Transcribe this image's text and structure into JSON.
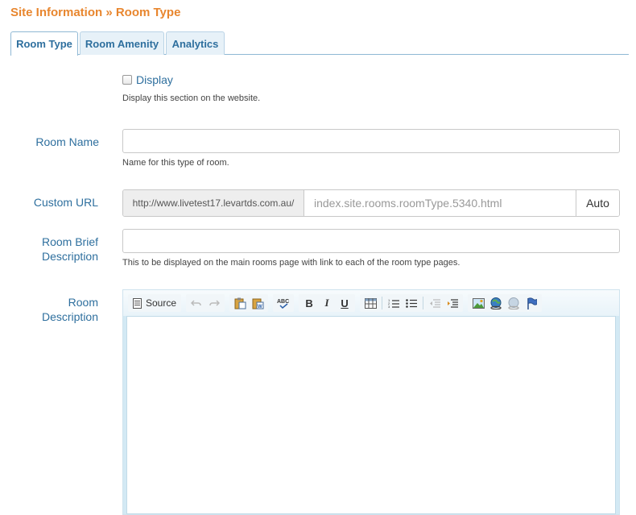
{
  "header": {
    "title": "Site Information » Room Type"
  },
  "tabs": [
    {
      "label": "Room Type",
      "active": true
    },
    {
      "label": "Room Amenity",
      "active": false
    },
    {
      "label": "Analytics",
      "active": false
    }
  ],
  "display": {
    "label": "Display",
    "checked": false,
    "help": "Display this section on the website."
  },
  "room_name": {
    "label": "Room Name",
    "value": "",
    "help": "Name for this type of room."
  },
  "custom_url": {
    "label": "Custom URL",
    "prefix": "http://www.livetest17.levartds.com.au/",
    "placeholder": "index.site.rooms.roomType.5340.html",
    "auto_label": "Auto"
  },
  "room_brief": {
    "label_line1": "Room Brief",
    "label_line2": "Description",
    "value": "",
    "help": "This to be displayed on the main rooms page with link to each of the room type pages."
  },
  "room_description": {
    "label_line1": "Room",
    "label_line2": "Description"
  },
  "toolbar": {
    "source_label": "Source",
    "bold": "B",
    "italic": "I",
    "underline": "U"
  },
  "colors": {
    "title": "#e8862e",
    "label": "#2e6f9e",
    "tab_bg": "#e7f1f8",
    "editor_frame": "#d3e9f4"
  }
}
